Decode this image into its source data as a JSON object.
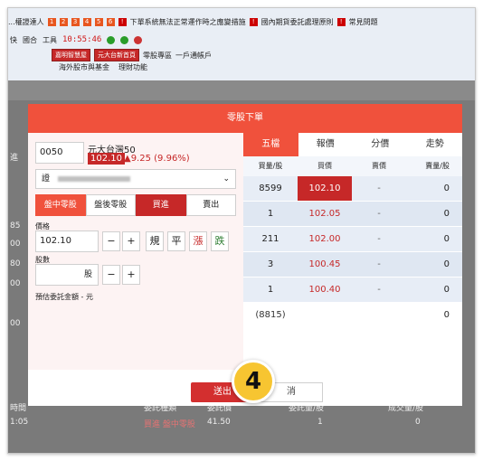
{
  "toolbar": {
    "row1": [
      "...權證達人",
      "下單系統無法正常運作時之應變措施",
      "國內期貨委託處理原則",
      "常見問題"
    ],
    "row1_chips": [
      "1",
      "2",
      "3",
      "4",
      "5",
      "6"
    ],
    "row2_left": "快",
    "row2_compound": "國合",
    "row2_tools": "工具",
    "clock": "10:55:46",
    "row3_buttons": [
      "嘉明智慧屋",
      "元大台新首頁"
    ],
    "row3_links": [
      "零股專區",
      "一戶通帳戶"
    ],
    "row4": [
      "海外股市與基金",
      "理財功能"
    ]
  },
  "background": {
    "left_labels": [
      "進",
      "85",
      "00",
      "80",
      "00",
      "00"
    ],
    "bottom_row": [
      "1:05",
      "買進 盤中零股",
      "41.50",
      "1",
      "0"
    ],
    "bottom_headers": [
      "時間",
      "委託種類",
      "委託價",
      "委託量/股",
      "成交量/股"
    ]
  },
  "modal": {
    "title": "零股下單",
    "code": "0050",
    "stock_name": "元大台灣50",
    "price": "102.10",
    "change": "▲9.25 (9.96%)",
    "account_prefix": "證",
    "tabs": [
      "盤中零股",
      "盤後零股",
      "買進",
      "賣出"
    ],
    "price_label": "價格",
    "price_value": "102.10",
    "price_buttons": [
      "規",
      "平",
      "漲",
      "跌"
    ],
    "qty_label": "股數",
    "qty_unit": "股",
    "estimate_label": "預估委託金額 - 元",
    "submit_label": "送出",
    "cancel_label": "消",
    "step_number": "4"
  },
  "quote": {
    "tabs": [
      "五檔",
      "報價",
      "分價",
      "走勢"
    ],
    "headers": [
      "買量/股",
      "買價",
      "賣價",
      "賣量/股"
    ],
    "rows": [
      {
        "bid_qty": "8599",
        "bid": "102.10",
        "ask": "-",
        "ask_qty": "0"
      },
      {
        "bid_qty": "1",
        "bid": "102.05",
        "ask": "-",
        "ask_qty": "0"
      },
      {
        "bid_qty": "211",
        "bid": "102.00",
        "ask": "-",
        "ask_qty": "0"
      },
      {
        "bid_qty": "3",
        "bid": "100.45",
        "ask": "-",
        "ask_qty": "0"
      },
      {
        "bid_qty": "1",
        "bid": "100.40",
        "ask": "-",
        "ask_qty": "0"
      }
    ],
    "total_bid": "(8815)",
    "total_ask": "0"
  },
  "colors": {
    "accent": "#f0513c",
    "up_red": "#c62828",
    "step_badge": "#f7c531"
  }
}
